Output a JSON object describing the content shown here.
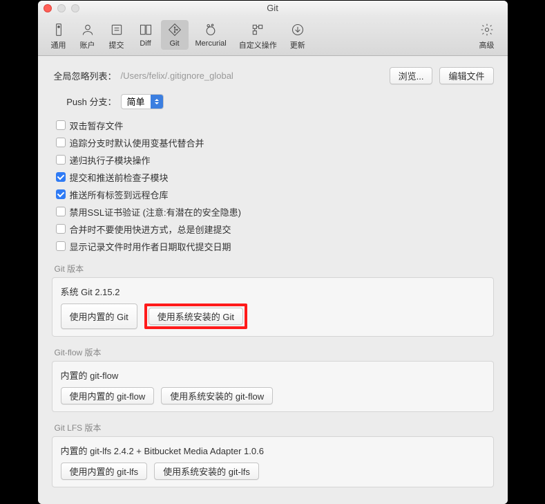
{
  "window": {
    "title": "Git"
  },
  "toolbar": {
    "items": [
      {
        "name": "general",
        "label": "通用"
      },
      {
        "name": "accounts",
        "label": "账户"
      },
      {
        "name": "commit",
        "label": "提交"
      },
      {
        "name": "diff",
        "label": "Diff"
      },
      {
        "name": "git",
        "label": "Git"
      },
      {
        "name": "mercurial",
        "label": "Mercurial"
      },
      {
        "name": "custom",
        "label": "自定义操作"
      },
      {
        "name": "updates",
        "label": "更新"
      }
    ],
    "advanced": "高级"
  },
  "settings": {
    "ignore_list_label": "全局忽略列表：",
    "ignore_list_path": "/Users/felix/.gitignore_global",
    "browse_btn": "浏览...",
    "edit_btn": "编辑文件",
    "push_branch_label": "Push 分支：",
    "push_branch_value": "简单",
    "checkboxes": [
      {
        "checked": false,
        "label": "双击暂存文件"
      },
      {
        "checked": false,
        "label": "追踪分支时默认使用变基代替合并"
      },
      {
        "checked": false,
        "label": "递归执行子模块操作"
      },
      {
        "checked": true,
        "label": "提交和推送前检查子模块"
      },
      {
        "checked": true,
        "label": "推送所有标签到远程仓库"
      },
      {
        "checked": false,
        "label": "禁用SSL证书验证 (注意:有潜在的安全隐患)"
      },
      {
        "checked": false,
        "label": "合并时不要使用快进方式，总是创建提交"
      },
      {
        "checked": false,
        "label": "显示记录文件时用作者日期取代提交日期"
      }
    ]
  },
  "sections": {
    "git": {
      "title": "Git 版本",
      "status": "系统 Git 2.15.2",
      "use_embedded": "使用内置的 Git",
      "use_system": "使用系统安装的 Git"
    },
    "gitflow": {
      "title": "Git-flow 版本",
      "status": "内置的 git-flow",
      "use_embedded": "使用内置的 git-flow",
      "use_system": "使用系统安装的 git-flow"
    },
    "gitlfs": {
      "title": "Git LFS 版本",
      "status": "内置的 git-lfs 2.4.2 + Bitbucket Media Adapter 1.0.6",
      "use_embedded": "使用内置的 git-lfs",
      "use_system": "使用系统安装的 git-lfs"
    }
  }
}
